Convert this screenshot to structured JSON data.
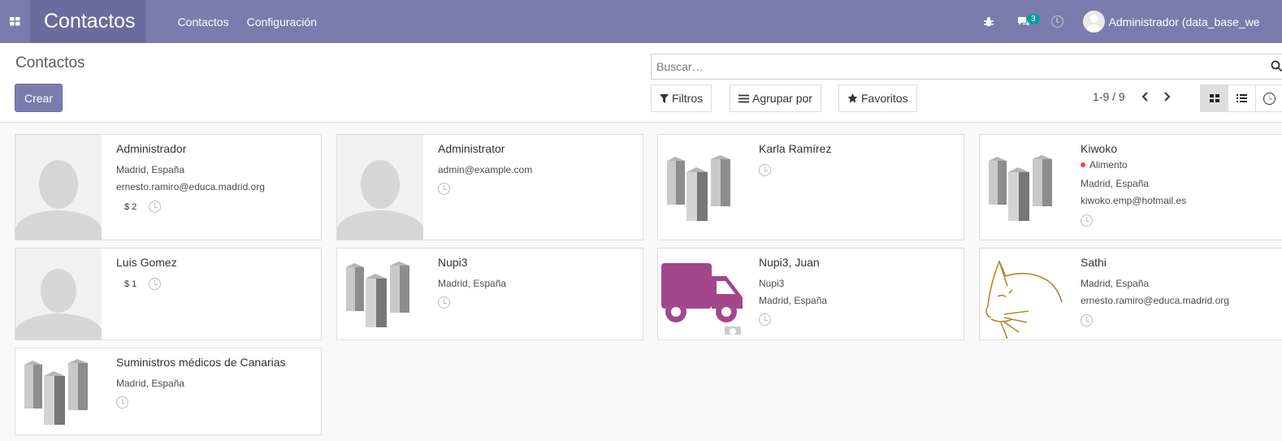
{
  "app": {
    "title": "Contactos"
  },
  "topmenu": [
    "Contactos",
    "Configuración"
  ],
  "systray": {
    "messages_badge": "3",
    "user_name": "Administrador (data_base_we"
  },
  "control_panel": {
    "breadcrumb": "Contactos",
    "create_label": "Crear",
    "search": {
      "placeholder": "Buscar…"
    },
    "filters_label": "Filtros",
    "groupby_label": "Agrupar por",
    "favorites_label": "Favoritos",
    "pager": "1-9 / 9"
  },
  "cards": [
    {
      "name": "Administrador",
      "lines": [
        "Madrid, España",
        "ernesto.ramiro@educa.madrid.org"
      ],
      "money": "$ 2",
      "image": "person-placeholder"
    },
    {
      "name": "Administrator",
      "lines": [
        "admin@example.com"
      ],
      "money": "",
      "image": "person-placeholder"
    },
    {
      "name": "Karla Ramírez",
      "lines": [],
      "money": "",
      "image": "company-buildings"
    },
    {
      "name": "Kiwoko",
      "tag": "Alimento",
      "lines": [
        "Madrid, España",
        "kiwoko.emp@hotmail.es"
      ],
      "money": "",
      "image": "company-buildings"
    },
    {
      "name": "Luis Gomez",
      "lines": [],
      "money": "$ 1",
      "image": "person-placeholder"
    },
    {
      "name": "Nupi3",
      "lines": [
        "Madrid, España"
      ],
      "money": "",
      "image": "company-buildings"
    },
    {
      "name": "Nupi3, Juan",
      "lines": [
        "Nupi3",
        "Madrid, España"
      ],
      "money": "",
      "image": "truck-logo"
    },
    {
      "name": "Sathi",
      "lines": [
        "Madrid, España",
        "ernesto.ramiro@educa.madrid.org"
      ],
      "money": "",
      "image": "cat-drawing"
    },
    {
      "name": "Suministros médicos de Canarias",
      "lines": [
        "Madrid, España"
      ],
      "money": "",
      "image": "company-buildings"
    }
  ],
  "colors": {
    "navbar": "#7c7bad",
    "brand": "#6c6b9d",
    "tag_red": "#f04646",
    "truck": "#a2478c"
  }
}
